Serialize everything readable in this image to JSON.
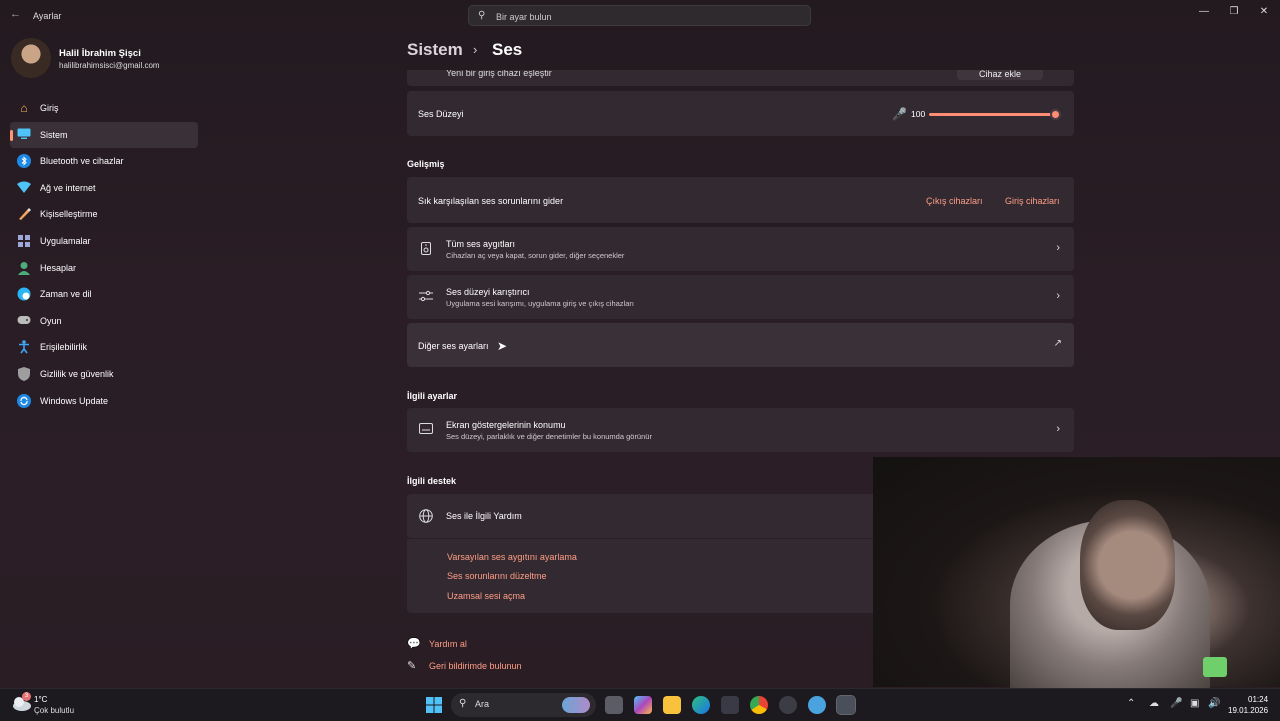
{
  "window": {
    "title": "Ayarlar",
    "search_placeholder": "Bir ayar bulun"
  },
  "profile": {
    "name": "Halil İbrahim Şişci",
    "email": "halilibrahimsisci@gmail.com"
  },
  "nav": {
    "items": [
      {
        "label": "Giriş",
        "icon": "home-icon"
      },
      {
        "label": "Sistem",
        "icon": "system-icon",
        "active": true
      },
      {
        "label": "Bluetooth ve cihazlar",
        "icon": "bluetooth-icon"
      },
      {
        "label": "Ağ ve internet",
        "icon": "wifi-icon"
      },
      {
        "label": "Kişiselleştirme",
        "icon": "brush-icon"
      },
      {
        "label": "Uygulamalar",
        "icon": "apps-icon"
      },
      {
        "label": "Hesaplar",
        "icon": "person-icon"
      },
      {
        "label": "Zaman ve dil",
        "icon": "globe-clock-icon"
      },
      {
        "label": "Oyun",
        "icon": "gamepad-icon"
      },
      {
        "label": "Erişilebilirlik",
        "icon": "accessibility-icon"
      },
      {
        "label": "Gizlilik ve güvenlik",
        "icon": "shield-icon"
      },
      {
        "label": "Windows Update",
        "icon": "update-icon"
      }
    ]
  },
  "breadcrumb": {
    "parent": "Sistem",
    "current": "Ses"
  },
  "content": {
    "pair_device": {
      "label": "Yeni bir giriş cihazı eşleştir",
      "button": "Cihaz ekle"
    },
    "volume": {
      "label": "Ses Düzeyi",
      "value": "100",
      "level": 1.0
    },
    "advanced": {
      "heading": "Gelişmiş",
      "troubleshoot": {
        "label": "Sık karşılaşılan ses sorunlarını gider",
        "output_link": "Çıkış cihazları",
        "input_link": "Giriş cihazları"
      },
      "all_devices": {
        "title": "Tüm ses aygıtları",
        "subtitle": "Cihazları aç veya kapat, sorun gider, diğer seçenekler"
      },
      "mixer": {
        "title": "Ses düzeyi karıştırıcı",
        "subtitle": "Uygulama sesi karışımı, uygulama giriş ve çıkış cihazları"
      },
      "more": {
        "label": "Diğer ses ayarları"
      }
    },
    "related": {
      "heading": "İlgili ayarlar",
      "osd": {
        "title": "Ekran göstergelerinin konumu",
        "subtitle": "Ses düzeyi, parlaklık ve diğer denetimler bu konumda görünür"
      }
    },
    "support": {
      "heading": "İlgili destek",
      "help": {
        "title": "Ses ile İlgili Yardım"
      },
      "links": [
        "Varsayılan ses aygıtını ayarlama",
        "Ses sorunlarını düzeltme",
        "Uzamsal sesi açma"
      ]
    },
    "footer": {
      "help": "Yardım al",
      "feedback": "Geri bildirimde bulunun"
    }
  },
  "taskbar": {
    "weather_temp": "1°C",
    "weather_desc": "Çok bulutlu",
    "weather_badge": "3",
    "search": "Ara",
    "time": "01:24",
    "date": "19.01.2026"
  },
  "colors": {
    "accent": "#ff9478",
    "link": "#ff9e86",
    "card": "#332a31"
  }
}
